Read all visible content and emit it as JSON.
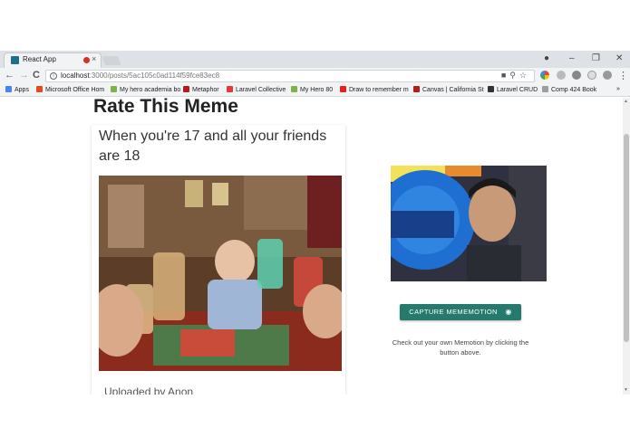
{
  "browser": {
    "tab_title": "React App",
    "tab_close": "×",
    "url_host": "localhost",
    "url_path": ":3000/posts/5ac105c0ad114f59fce83ec8",
    "back": "←",
    "forward": "→",
    "reload": "C",
    "minimize": "–",
    "restore": "❐",
    "close": "✕",
    "menu": "⋮",
    "account": "●"
  },
  "bookmarks": [
    {
      "label": "Apps",
      "color": "#4285f4"
    },
    {
      "label": "Microsoft Office Hom",
      "color": "#e64a19"
    },
    {
      "label": "My hero academia bo",
      "color": "#7cb342"
    },
    {
      "label": "Metaphor",
      "color": "#b71c1c"
    },
    {
      "label": "Laravel Collective",
      "color": "#e53935"
    },
    {
      "label": "My Hero 80",
      "color": "#7cb342"
    },
    {
      "label": "Draw to remember m",
      "color": "#e62117"
    },
    {
      "label": "Canvas | California St",
      "color": "#b71c1c"
    },
    {
      "label": "Laravel CRUD",
      "color": "#333333"
    },
    {
      "label": "Comp 424 Book",
      "color": "#9e9e9e"
    }
  ],
  "bookmarks_more": "»",
  "page": {
    "title": "Rate This Meme",
    "meme_caption": "When you're 17 and all your friends are 18",
    "uploaded_by": "Uploaded by Anon",
    "capture_label": "CAPTURE MEMEMOTION",
    "helper_text": "Check out your own Memotion by clicking the button above."
  },
  "colors": {
    "accent": "#26796d",
    "tab_favicon": "#1e6f8a",
    "recording": "#d93025"
  },
  "icons": [
    "info-icon",
    "camera-icon",
    "search-icon",
    "star-icon",
    "cast-icon",
    "menu-icon"
  ]
}
